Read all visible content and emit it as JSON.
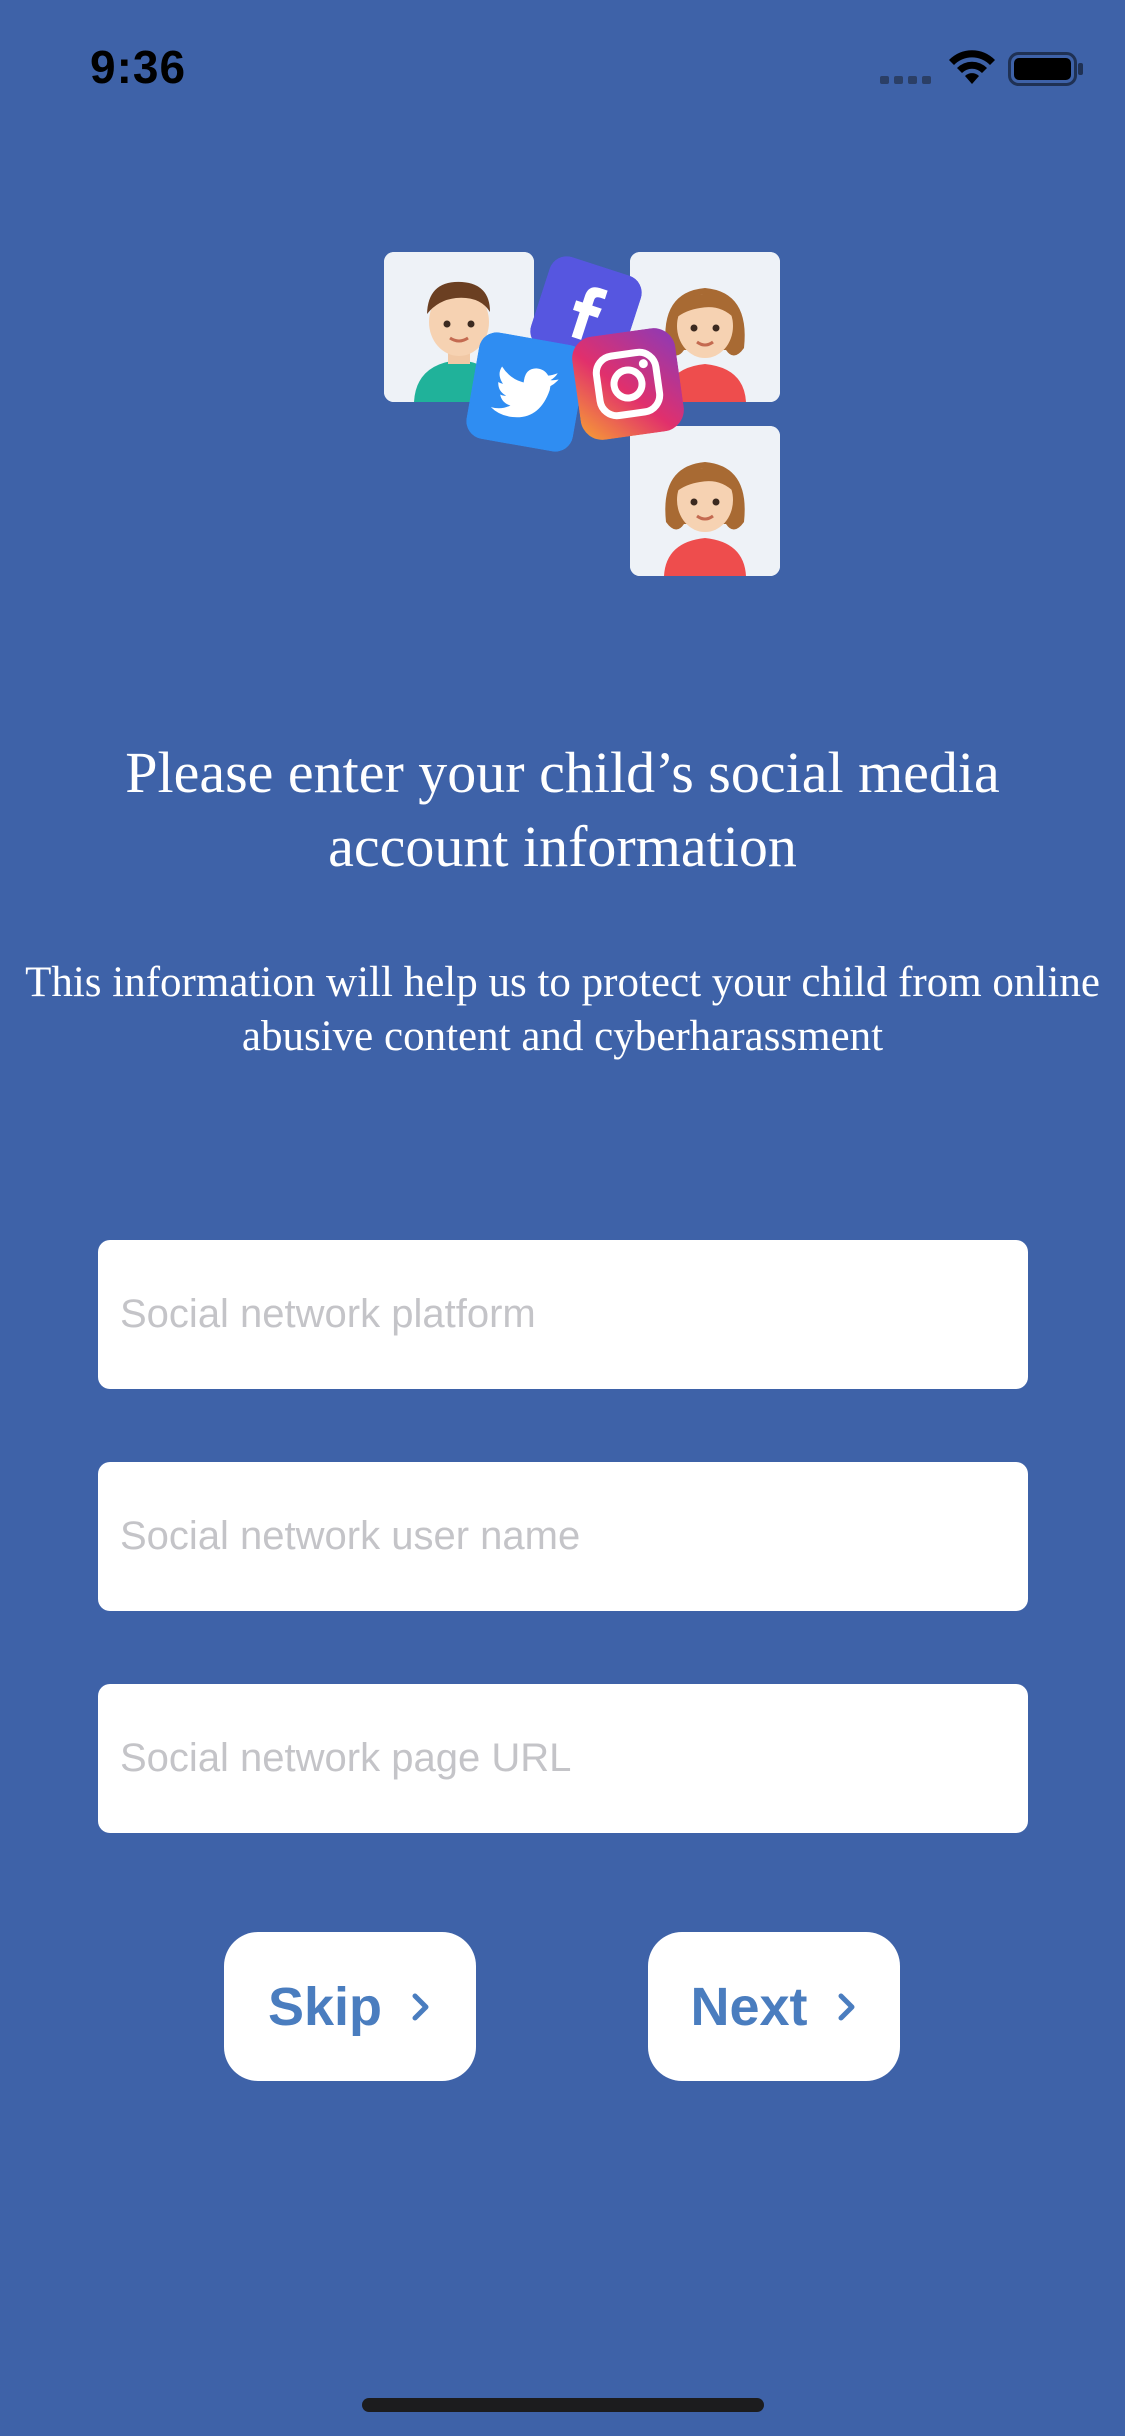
{
  "status_bar": {
    "time": "9:36"
  },
  "page": {
    "title": "Please enter your child’s social media account information",
    "subtitle": "This information will help us to protect your child from online abusive content and cyberharassment"
  },
  "form": {
    "platform_placeholder": "Social network platform",
    "username_placeholder": "Social network user name",
    "url_placeholder": "Social network page URL"
  },
  "actions": {
    "skip_label": "Skip",
    "next_label": "Next"
  },
  "colors": {
    "background": "#3e62a8",
    "button_text": "#4a7dbf",
    "field_background": "#ffffff"
  },
  "icons": [
    "signal-icon",
    "wifi-icon",
    "battery-icon",
    "boy-avatar-icon",
    "girl-avatar-icon",
    "facebook-icon",
    "twitter-icon",
    "instagram-icon",
    "chevron-right-icon"
  ]
}
